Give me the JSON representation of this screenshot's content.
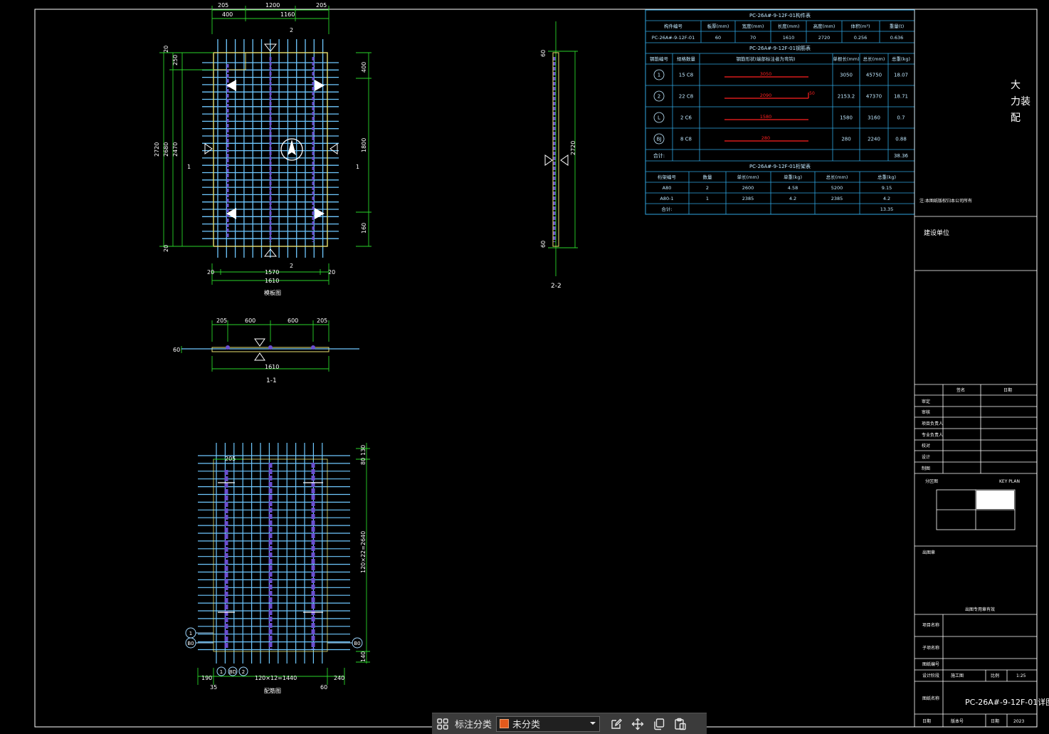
{
  "drawing": {
    "top_dims": [
      "205",
      "1200",
      "205",
      "400",
      "1160"
    ],
    "plan_left_dims": [
      "20",
      "250",
      "2720",
      "2680",
      "2470",
      "20"
    ],
    "plan_right_dims": [
      "400",
      "1800",
      "160"
    ],
    "plan_bottom_dims": [
      "20",
      "1570",
      "20",
      "1610"
    ],
    "plan_section_marks": [
      "2",
      "2",
      "1",
      "1"
    ],
    "plan_title": "模板图",
    "section11_dims": [
      "205",
      "600",
      "600",
      "205",
      "1610",
      "60"
    ],
    "section11_title": "1-1",
    "section22_dims": [
      "60",
      "2720",
      "60"
    ],
    "section22_title": "2-2",
    "rebar_right_dims": [
      "130",
      "80",
      "120×22=2640",
      "140"
    ],
    "rebar_bottom_dims": [
      "190",
      "205",
      "120×12=1440",
      "240",
      "35",
      "60"
    ],
    "rebar_top_dim": "205",
    "rebar_tags": [
      "1",
      "BD",
      "3",
      "2",
      "B0",
      "B0"
    ],
    "rebar_title": "配筋图"
  },
  "tables": {
    "component": {
      "title": "PC-26A#-9-12F-01构件表",
      "headers": [
        "构件编号",
        "板厚(mm)",
        "宽度(mm)",
        "长度(mm)",
        "高度(mm)",
        "体积(m³)",
        "重量(t)"
      ],
      "row": [
        "PC-26A#-9-12F-01",
        "60",
        "70",
        "1610",
        "2720",
        "0.256",
        "0.636"
      ]
    },
    "rebar": {
      "title": "PC-26A#-9-12F-01钢筋表",
      "headers": [
        "钢筋编号",
        "规格数量",
        "钢筋形状(端部标注者为弯钩)",
        "单根长(mm)",
        "总长(mm)",
        "总重(kg)"
      ],
      "rows": [
        {
          "id": "1",
          "spec": "15 C8",
          "shape": "3050",
          "len": "3050",
          "total": "45750",
          "weight": "18.07"
        },
        {
          "id": "2",
          "spec": "22 C8",
          "shape": "2090",
          "hook": "50",
          "len": "2153.2",
          "total": "47370",
          "weight": "18.71"
        },
        {
          "id": "L",
          "spec": "2 C6",
          "shape": "1580",
          "len": "1580",
          "total": "3160",
          "weight": "0.7"
        },
        {
          "id": "BJ",
          "spec": "8 C8",
          "shape": "280",
          "len": "280",
          "total": "2240",
          "weight": "0.88"
        }
      ],
      "total_label": "合计:",
      "total_value": "38.36"
    },
    "truss": {
      "title": "PC-26A#-9-12F-01桁架表",
      "headers": [
        "桁架编号",
        "数量",
        "单长(mm)",
        "单重(kg)",
        "总长(mm)",
        "总重(kg)"
      ],
      "rows": [
        [
          "A80",
          "2",
          "2600",
          "4.58",
          "5200",
          "9.15"
        ],
        [
          "A80-1",
          "1",
          "2385",
          "4.2",
          "2385",
          "4.2"
        ]
      ],
      "total_label": "合计:",
      "total_value": "13.35"
    }
  },
  "titleblock": {
    "side_title": [
      "大",
      "力装",
      "配"
    ],
    "note": "注:本图纸版权归本公司所有",
    "company": "建设单位",
    "sig_header": [
      "签名",
      "日期"
    ],
    "sig_rows": [
      "审定",
      "审核",
      "项目负责人",
      "专业负责人",
      "校对",
      "设计",
      "制图"
    ],
    "keyplan_left": "分区图",
    "keyplan_right": "KEY PLAN",
    "seal_label": "出图章",
    "seal_note": "出图专用章有效",
    "project_label": "项目名称",
    "subitem_label": "子项名称",
    "drawing_no_label": "图纸编号",
    "phase_label": "设计阶段",
    "phase_value": "施工图",
    "scale_label": "比例",
    "scale_value": "1:25",
    "drawing_name_label": "图纸名称",
    "drawing_name": "PC-26A#-9-12F-01详图",
    "date_row_label": "日期",
    "version_label": "版本号",
    "date_label": "日期",
    "date_value": "2023"
  },
  "toolbar": {
    "label": "标注分类",
    "selected": "未分类",
    "swatch_color": "#e25a1c",
    "icons": [
      "grid-icon",
      "chevron-down-icon",
      "edit-icon",
      "move-icon",
      "copy-icon",
      "paste-icon"
    ]
  },
  "colors": {
    "background": "#000000",
    "border": "#ffffff",
    "table": "#2fa6e0",
    "dimension": "#2ad42a",
    "rebar": "#6fc8ff",
    "truss": "#6a4fd0",
    "outline": "#e8e070",
    "shape_red": "#ff2020"
  }
}
